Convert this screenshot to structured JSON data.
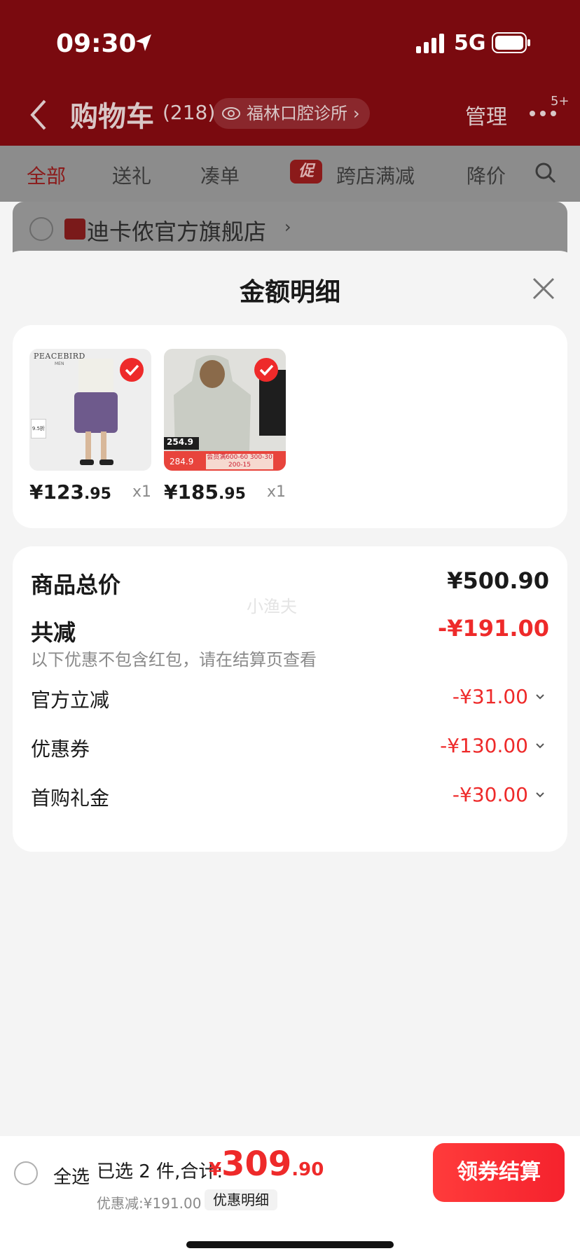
{
  "status": {
    "time": "09:30",
    "network": "5G"
  },
  "nav": {
    "title": "购物车",
    "count": "(218)",
    "address": "福林口腔诊所",
    "address_chev": "›",
    "manage": "管理",
    "more_badge": "5+"
  },
  "tabs": [
    {
      "label": "全部"
    },
    {
      "label": "送礼"
    },
    {
      "label": "凑单"
    },
    {
      "label": "跨店满减",
      "badge": "促"
    },
    {
      "label": "降价"
    }
  ],
  "store": {
    "name": "迪卡侬官方旗舰店",
    "chev": "›"
  },
  "sheet": {
    "title": "金额明细",
    "watermark": "小渔夫",
    "products": [
      {
        "brand": "PEACEBIRD",
        "brand_sub": "MEN",
        "tag": "9.5折",
        "price_int": "¥123",
        "price_dec": ".95",
        "qty": "x1"
      },
      {
        "ad_price1": "254.9",
        "ad_price2": "284.9",
        "ad_note": "会员满600-60 300-30 200-15",
        "price_int": "¥185",
        "price_dec": ".95",
        "qty": "x1"
      }
    ],
    "summary": {
      "total_label": "商品总价",
      "total_value": "¥500.90",
      "reduce_label": "共减",
      "reduce_value": "-¥191.00",
      "note": "以下优惠不包含红包，请在结算页查看",
      "discounts": [
        {
          "label": "官方立减",
          "value": "-¥31.00"
        },
        {
          "label": "优惠券",
          "value": "-¥130.00"
        },
        {
          "label": "首购礼金",
          "value": "-¥30.00"
        }
      ]
    }
  },
  "bottom": {
    "select_all": "全选",
    "selected": "已选 2 件,合计:",
    "currency": "¥",
    "total_int": "309",
    "total_dec": ".90",
    "saved": "优惠减:¥191.00",
    "detail": "优惠明细",
    "checkout": "领券结算"
  },
  "colors": {
    "accent": "#ee2a2a",
    "header": "#7a0a0f"
  },
  "icons": [
    "location-arrow-icon",
    "signal-icon",
    "battery-icon",
    "back-icon",
    "eye-icon",
    "more-icon",
    "search-icon",
    "close-icon",
    "check-icon",
    "chevron-down-icon"
  ]
}
